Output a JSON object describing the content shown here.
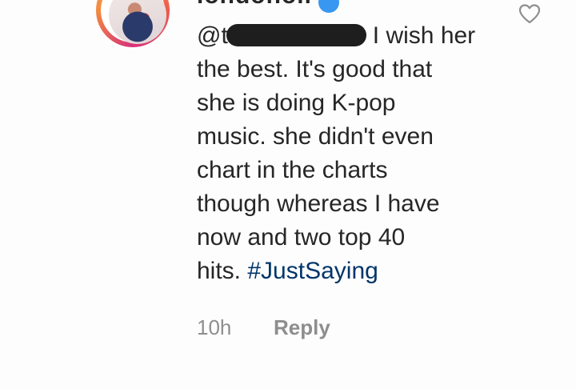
{
  "comment": {
    "username": "londonoll",
    "mention": "@t",
    "lines": [
      "I wish her",
      "the best. It's good that",
      "she is doing K-pop",
      "music. she didn't even",
      "chart in the charts",
      "though whereas I have",
      "now and two top 40",
      "hits."
    ],
    "hashtag": "#JustSaying",
    "timestamp": "10h",
    "reply_label": "Reply"
  },
  "icons": {
    "like": "heart-icon",
    "verified": "verified-badge-icon"
  },
  "colors": {
    "text": "#262626",
    "hashtag": "#003569",
    "meta": "#8e8e8e",
    "verified": "#3897f0"
  }
}
